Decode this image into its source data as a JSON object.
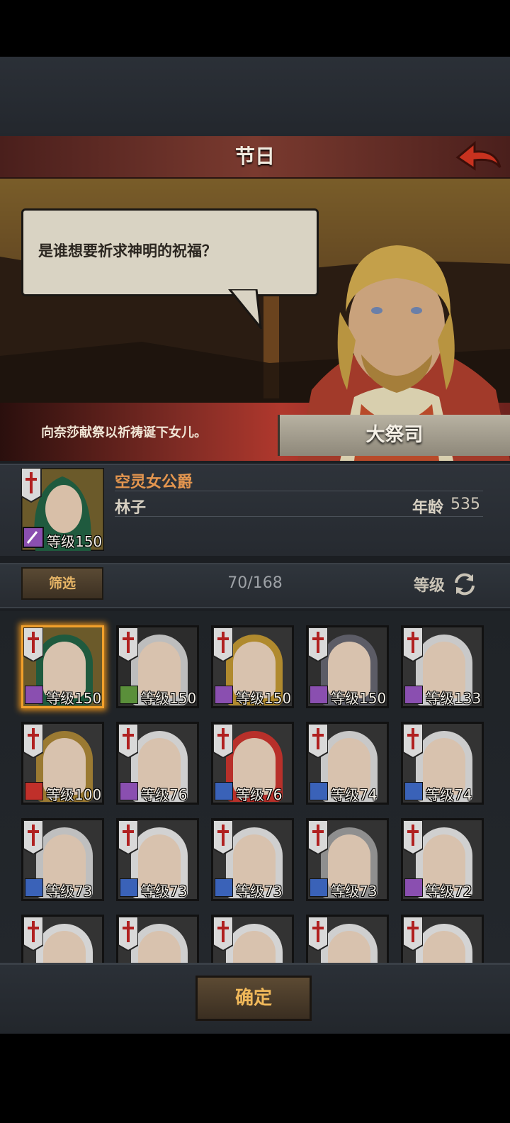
{
  "header": {
    "title": "节日"
  },
  "dialogue": {
    "speech": "是谁想要祈求神明的祝福？",
    "description": "向奈莎献祭以祈祷诞下女儿。",
    "speaker_name": "大祭司"
  },
  "selected": {
    "title": "空灵女公爵",
    "name": "林子",
    "age_label": "年龄",
    "age_value": "535",
    "level_label": "等级",
    "level_value": "150"
  },
  "filter": {
    "button_label": "筛选",
    "count": "70/168",
    "sort_label": "等级"
  },
  "characters": [
    {
      "level_label": "等级",
      "level": "150",
      "class_color": "#8a4fb0",
      "selected": true,
      "hair": "#1f5a3e",
      "bg": "#6b5a2a"
    },
    {
      "level_label": "等级",
      "level": "150",
      "class_color": "#5a8f3a",
      "selected": false,
      "hair": "#bdbdbd",
      "bg": "#2c2c2c"
    },
    {
      "level_label": "等级",
      "level": "150",
      "class_color": "#8a4fb0",
      "selected": false,
      "hair": "#b08a2e",
      "bg": "#343434"
    },
    {
      "level_label": "等级",
      "level": "150",
      "class_color": "#8a4fb0",
      "selected": false,
      "hair": "#5c5c66",
      "bg": "#2f2f2f"
    },
    {
      "level_label": "等级",
      "level": "133",
      "class_color": "#8a4fb0",
      "selected": false,
      "hair": "#c9c9c9",
      "bg": "#333333"
    },
    {
      "level_label": "等级",
      "level": "100",
      "class_color": "#c0302a",
      "selected": false,
      "hair": "#9b7a32",
      "bg": "#353535"
    },
    {
      "level_label": "等级",
      "level": "76",
      "class_color": "#8a4fb0",
      "selected": false,
      "hair": "#cfcfcf",
      "bg": "#333333"
    },
    {
      "level_label": "等级",
      "level": "76",
      "class_color": "#3a62b8",
      "selected": false,
      "hair": "#b8302a",
      "bg": "#343434"
    },
    {
      "level_label": "等级",
      "level": "74",
      "class_color": "#3a62b8",
      "selected": false,
      "hair": "#c8c8c8",
      "bg": "#323232"
    },
    {
      "level_label": "等级",
      "level": "74",
      "class_color": "#3a62b8",
      "selected": false,
      "hair": "#cccccc",
      "bg": "#333333"
    },
    {
      "level_label": "等级",
      "level": "73",
      "class_color": "#3a62b8",
      "selected": false,
      "hair": "#bfbfbf",
      "bg": "#333333"
    },
    {
      "level_label": "等级",
      "level": "73",
      "class_color": "#3a62b8",
      "selected": false,
      "hair": "#d2d2d2",
      "bg": "#333333"
    },
    {
      "level_label": "等级",
      "level": "73",
      "class_color": "#3a62b8",
      "selected": false,
      "hair": "#cfcfcf",
      "bg": "#333333"
    },
    {
      "level_label": "等级",
      "level": "73",
      "class_color": "#3a62b8",
      "selected": false,
      "hair": "#8f8f8f",
      "bg": "#333333"
    },
    {
      "level_label": "等级",
      "level": "72",
      "class_color": "#8a4fb0",
      "selected": false,
      "hair": "#d0d0d0",
      "bg": "#333333"
    },
    {
      "level_label": "",
      "level": "",
      "class_color": "#333333",
      "selected": false,
      "hair": "#d4d4d4",
      "bg": "#333333"
    },
    {
      "level_label": "",
      "level": "",
      "class_color": "#333333",
      "selected": false,
      "hair": "#cfcfcf",
      "bg": "#333333"
    },
    {
      "level_label": "",
      "level": "",
      "class_color": "#333333",
      "selected": false,
      "hair": "#d4d4d4",
      "bg": "#333333"
    },
    {
      "level_label": "",
      "level": "",
      "class_color": "#333333",
      "selected": false,
      "hair": "#cfcfcf",
      "bg": "#333333"
    },
    {
      "level_label": "",
      "level": "",
      "class_color": "#333333",
      "selected": false,
      "hair": "#d4d4d4",
      "bg": "#333333"
    }
  ],
  "confirm": {
    "label": "确定"
  },
  "colors": {
    "accent": "#f0b85a",
    "title_orange": "#e4964f",
    "selection_glow": "#f2a02b"
  },
  "icons": {
    "back": "back-arrow-icon",
    "sort": "refresh-icon",
    "banner": "crusader-banner-icon"
  }
}
